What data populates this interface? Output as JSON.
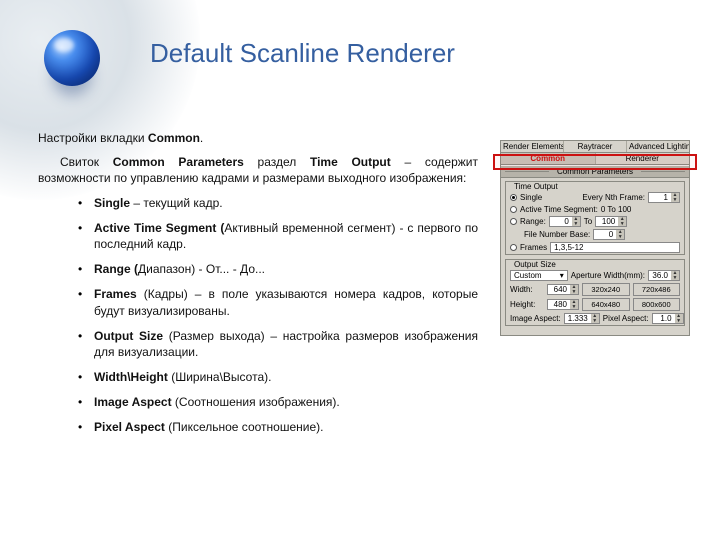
{
  "title": "Default Scanline Renderer",
  "intro": {
    "line1_a": "Настройки вкладки ",
    "line1_b": "Common",
    "line1_c": ".",
    "line2_a": "Свиток ",
    "line2_b": "Common Parameters",
    "line2_c": " раздел ",
    "line2_d": "Time Output",
    "line2_e": " – содержит возможности по управлению кадрами и размерами выходного изображения:"
  },
  "bullets": [
    {
      "b": "Single",
      "rest": " – текущий кадр."
    },
    {
      "b": "Active Time Segment (",
      "rest": "Активный временной сегмент) - с первого по последний кадр."
    },
    {
      "b": "Range (",
      "rest": "Диапазон) - От... - До..."
    },
    {
      "b": "Frames",
      "rest": " (Кадры) – в поле указываются номера кадров, которые будут визуализированы."
    },
    {
      "b": "Output Size",
      "rest": " (Размер выхода) – настройка размеров изображения для визуализации."
    },
    {
      "b": "Width\\Height",
      "rest": " (Ширина\\Высота)."
    },
    {
      "b": "Image Aspect",
      "rest": " (Соотношения изображения)."
    },
    {
      "b": "Pixel Aspect",
      "rest": " (Пиксельное соотношение)."
    }
  ],
  "dialog": {
    "tabs_row1": [
      "Render Elements",
      "Raytracer",
      "Advanced Lighting"
    ],
    "tabs_row2": [
      "Common",
      "Renderer"
    ],
    "roll_common": "Common Parameters",
    "time_output": {
      "title": "Time Output",
      "single": "Single",
      "every_nth": "Every Nth Frame:",
      "every_nth_val": "1",
      "ats": "Active Time Segment:",
      "ats_range": "0 To 100",
      "range": "Range:",
      "r_from": "0",
      "r_to_lbl": "To",
      "r_to": "100",
      "file_base": "File Number Base:",
      "file_base_val": "0",
      "frames": "Frames",
      "frames_val": "1,3,5-12"
    },
    "output_size": {
      "title": "Output Size",
      "custom": "Custom",
      "aperture_lbl": "Aperture Width(mm):",
      "aperture_val": "36.0",
      "width_lbl": "Width:",
      "width_val": "640",
      "height_lbl": "Height:",
      "height_val": "480",
      "preset1": "320x240",
      "preset2": "720x486",
      "preset3": "640x480",
      "preset4": "800x600",
      "img_aspect_lbl": "Image Aspect:",
      "img_aspect_val": "1.333",
      "pixel_aspect_lbl": "Pixel Aspect:",
      "pixel_aspect_val": "1.0"
    }
  }
}
